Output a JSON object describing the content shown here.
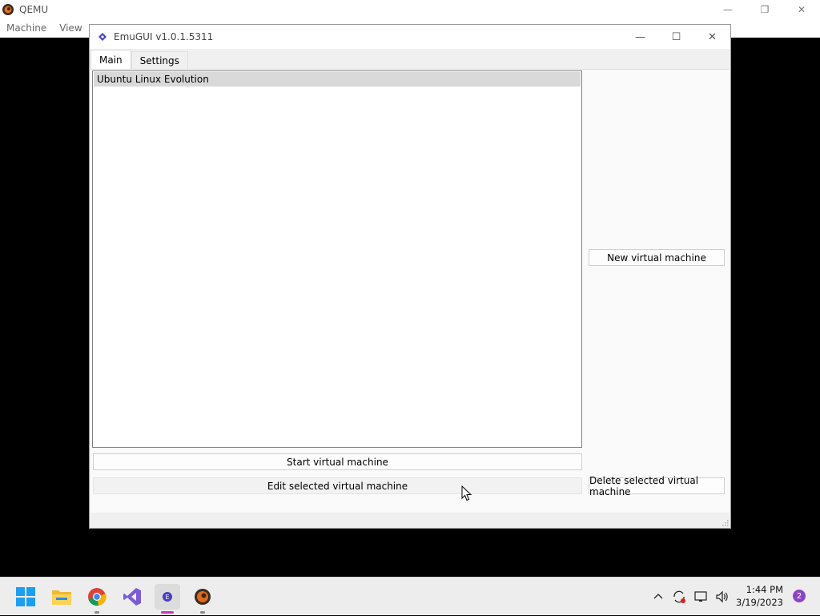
{
  "qemu": {
    "title": "QEMU",
    "menu": [
      "Machine",
      "View"
    ],
    "controls": {
      "minimize": "—",
      "restore": "❐",
      "close": "✕"
    }
  },
  "emugui": {
    "title": "EmuGUI v1.0.1.5311",
    "controls": {
      "minimize": "—",
      "maximize": "☐",
      "close": "✕"
    },
    "tabs": [
      {
        "label": "Main",
        "active": true
      },
      {
        "label": "Settings",
        "active": false
      }
    ],
    "vm_list": [
      {
        "name": "Ubuntu Linux Evolution",
        "selected": true
      }
    ],
    "buttons": {
      "new_vm": "New virtual machine",
      "start_vm": "Start virtual machine",
      "edit_vm": "Edit selected virtual machine",
      "delete_vm": "Delete selected virtual machine"
    }
  },
  "taskbar": {
    "apps": [
      "start-icon",
      "file-explorer-icon",
      "chrome-icon",
      "visual-studio-icon",
      "emugui-icon",
      "qemu-icon"
    ],
    "active_app": "emugui-icon",
    "clock": {
      "time": "1:44 PM",
      "date": "3/19/2023"
    },
    "notification_count": "2"
  },
  "colors": {
    "accent": "#c03fbc",
    "selection": "#d9d9d9",
    "notification": "#8d44c4"
  }
}
